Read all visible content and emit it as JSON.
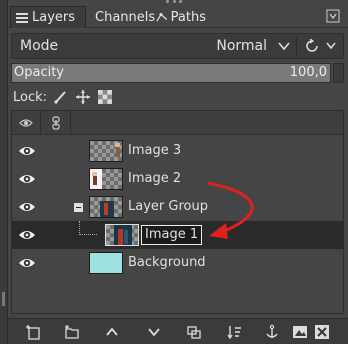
{
  "tabs": [
    {
      "label": "Layers",
      "icon": "layers-icon",
      "active": true
    },
    {
      "label": "Channels",
      "icon": "channels-icon",
      "active": false
    },
    {
      "label": "Paths",
      "icon": "paths-icon",
      "active": false
    }
  ],
  "mode": {
    "label": "Mode",
    "value": "Normal"
  },
  "opacity": {
    "label": "Opacity",
    "value": "100,0",
    "percent": 100
  },
  "lock": {
    "label": "Lock:"
  },
  "layers": [
    {
      "name": "Image 3",
      "visible": true,
      "selected": false
    },
    {
      "name": "Image 2",
      "visible": true,
      "selected": false
    },
    {
      "name": "Layer Group",
      "visible": true,
      "selected": false,
      "group": true
    },
    {
      "name": "Image 1",
      "visible": true,
      "selected": true,
      "child": true
    },
    {
      "name": "Background",
      "visible": true,
      "selected": false
    }
  ],
  "colors": {
    "panel_bg": "#454545",
    "selected_row": "#2a2a2a",
    "background_thumb": "#9fe0e0",
    "annotation_arrow": "#e02020"
  },
  "toolbar_icons": [
    "new-layer-icon",
    "new-group-icon",
    "raise-icon",
    "lower-icon",
    "duplicate-icon",
    "merge-down-icon",
    "anchor-icon",
    "mask-icon",
    "delete-icon"
  ]
}
